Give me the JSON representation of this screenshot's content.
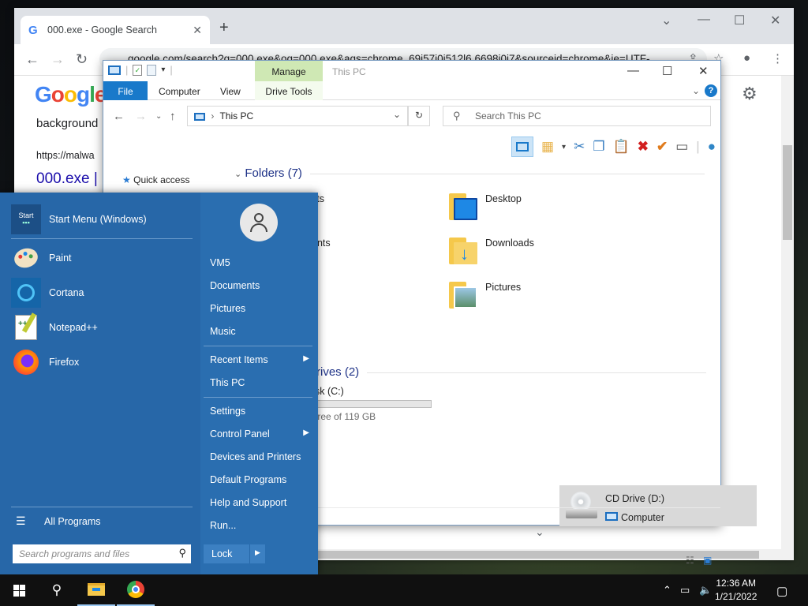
{
  "chrome": {
    "tab_title": "000.exe - Google Search",
    "url": "google.com/search?q=000.exe&oq=000.exe&aqs=chrome..69i57j0i512l6.6698j0j7&sourceid=chrome&ie=UTF-...",
    "page_texts": [
      "background",
      "https://malwa",
      "000.exe |"
    ],
    "logo": "Google"
  },
  "explorer": {
    "manage_label": "Manage",
    "window_title": "This PC",
    "tabs": {
      "file": "File",
      "computer": "Computer",
      "view": "View",
      "drive_tools": "Drive Tools"
    },
    "address": "This PC",
    "search_placeholder": "Search This PC",
    "quick_access": "Quick access",
    "folders_header": "Folders (7)",
    "folders": [
      "Desktop",
      "Downloads",
      "Pictures"
    ],
    "partial_labels": [
      "cts",
      "ents"
    ],
    "drives_header": "rives (2)",
    "local_disk_name": "sk (C:)",
    "local_disk_free": "free of 119 GB",
    "cd_drive": "CD Drive (D:)",
    "status_computer": "Computer"
  },
  "start_menu": {
    "programs": [
      {
        "label": "Start Menu (Windows)",
        "icon": "start-menu-icon"
      },
      {
        "label": "Paint",
        "icon": "paint-icon"
      },
      {
        "label": "Cortana",
        "icon": "cortana-icon"
      },
      {
        "label": "Notepad++",
        "icon": "notepad-plus-plus-icon"
      },
      {
        "label": "Firefox",
        "icon": "firefox-icon"
      }
    ],
    "all_programs": "All Programs",
    "search_placeholder": "Search programs and files",
    "right_items": [
      "VM5",
      "Documents",
      "Pictures",
      "Music",
      "Recent Items",
      "This PC",
      "Settings",
      "Control Panel",
      "Devices and Printers",
      "Default Programs",
      "Help and Support",
      "Run..."
    ],
    "lock": "Lock"
  },
  "taskbar": {
    "time": "12:36 AM",
    "date": "1/21/2022"
  }
}
